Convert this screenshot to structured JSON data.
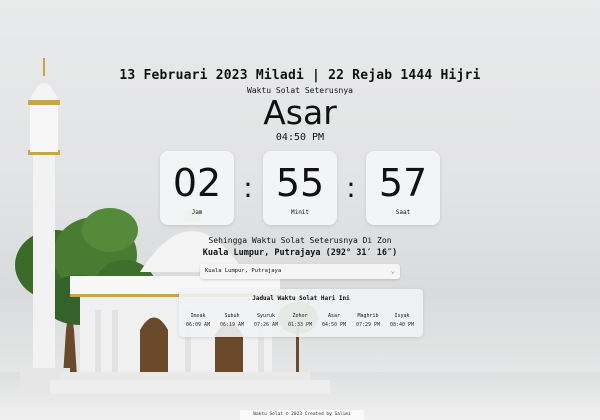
{
  "header": {
    "date_line": "13 Februari 2023 Miladi | 22 Rejab 1444 Hijri",
    "subtitle": "Waktu Solat Seterusnya",
    "next_prayer": "Asar",
    "next_prayer_time": "04:50 PM"
  },
  "countdown": {
    "hours": "02",
    "minutes": "55",
    "seconds": "57",
    "hours_label": "Jam",
    "minutes_label": "Minit",
    "seconds_label": "Saat",
    "separator": ":"
  },
  "zone": {
    "caption": "Sehingga Waktu Solat Seterusnya Di Zon",
    "name": "Kuala Lumpur, Putrajaya (292° 31′ 16″)",
    "select_value": "Kuala Lumpur, Putrajaya"
  },
  "schedule": {
    "title": "Jadual Waktu Solat Hari Ini",
    "items": [
      {
        "name": "Imsak",
        "time": "06:09 AM"
      },
      {
        "name": "Subuh",
        "time": "06:19 AM"
      },
      {
        "name": "Syuruk",
        "time": "07:26 AM"
      },
      {
        "name": "Zohor",
        "time": "01:33 PM"
      },
      {
        "name": "Asar",
        "time": "04:50 PM"
      },
      {
        "name": "Maghrib",
        "time": "07:29 PM"
      },
      {
        "name": "Isyak",
        "time": "08:40 PM"
      }
    ]
  },
  "footer": {
    "text": "Waktu Solat © 2023 Created by Salimi"
  },
  "icons": {
    "select_chevron": "chevron-down-icon"
  },
  "colors": {
    "background": "#e4e5e6",
    "card": "#f3f4f5",
    "text": "#111111",
    "gold": "#c9a44a",
    "tree": "#3f6f2c"
  }
}
